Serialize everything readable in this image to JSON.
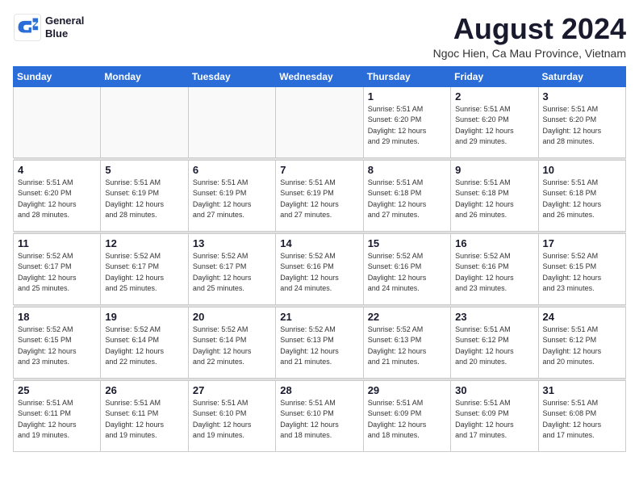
{
  "logo": {
    "line1": "General",
    "line2": "Blue"
  },
  "title": "August 2024",
  "location": "Ngoc Hien, Ca Mau Province, Vietnam",
  "weekdays": [
    "Sunday",
    "Monday",
    "Tuesday",
    "Wednesday",
    "Thursday",
    "Friday",
    "Saturday"
  ],
  "weeks": [
    [
      {
        "day": "",
        "info": ""
      },
      {
        "day": "",
        "info": ""
      },
      {
        "day": "",
        "info": ""
      },
      {
        "day": "",
        "info": ""
      },
      {
        "day": "1",
        "info": "Sunrise: 5:51 AM\nSunset: 6:20 PM\nDaylight: 12 hours\nand 29 minutes."
      },
      {
        "day": "2",
        "info": "Sunrise: 5:51 AM\nSunset: 6:20 PM\nDaylight: 12 hours\nand 29 minutes."
      },
      {
        "day": "3",
        "info": "Sunrise: 5:51 AM\nSunset: 6:20 PM\nDaylight: 12 hours\nand 28 minutes."
      }
    ],
    [
      {
        "day": "4",
        "info": "Sunrise: 5:51 AM\nSunset: 6:20 PM\nDaylight: 12 hours\nand 28 minutes."
      },
      {
        "day": "5",
        "info": "Sunrise: 5:51 AM\nSunset: 6:19 PM\nDaylight: 12 hours\nand 28 minutes."
      },
      {
        "day": "6",
        "info": "Sunrise: 5:51 AM\nSunset: 6:19 PM\nDaylight: 12 hours\nand 27 minutes."
      },
      {
        "day": "7",
        "info": "Sunrise: 5:51 AM\nSunset: 6:19 PM\nDaylight: 12 hours\nand 27 minutes."
      },
      {
        "day": "8",
        "info": "Sunrise: 5:51 AM\nSunset: 6:18 PM\nDaylight: 12 hours\nand 27 minutes."
      },
      {
        "day": "9",
        "info": "Sunrise: 5:51 AM\nSunset: 6:18 PM\nDaylight: 12 hours\nand 26 minutes."
      },
      {
        "day": "10",
        "info": "Sunrise: 5:51 AM\nSunset: 6:18 PM\nDaylight: 12 hours\nand 26 minutes."
      }
    ],
    [
      {
        "day": "11",
        "info": "Sunrise: 5:52 AM\nSunset: 6:17 PM\nDaylight: 12 hours\nand 25 minutes."
      },
      {
        "day": "12",
        "info": "Sunrise: 5:52 AM\nSunset: 6:17 PM\nDaylight: 12 hours\nand 25 minutes."
      },
      {
        "day": "13",
        "info": "Sunrise: 5:52 AM\nSunset: 6:17 PM\nDaylight: 12 hours\nand 25 minutes."
      },
      {
        "day": "14",
        "info": "Sunrise: 5:52 AM\nSunset: 6:16 PM\nDaylight: 12 hours\nand 24 minutes."
      },
      {
        "day": "15",
        "info": "Sunrise: 5:52 AM\nSunset: 6:16 PM\nDaylight: 12 hours\nand 24 minutes."
      },
      {
        "day": "16",
        "info": "Sunrise: 5:52 AM\nSunset: 6:16 PM\nDaylight: 12 hours\nand 23 minutes."
      },
      {
        "day": "17",
        "info": "Sunrise: 5:52 AM\nSunset: 6:15 PM\nDaylight: 12 hours\nand 23 minutes."
      }
    ],
    [
      {
        "day": "18",
        "info": "Sunrise: 5:52 AM\nSunset: 6:15 PM\nDaylight: 12 hours\nand 23 minutes."
      },
      {
        "day": "19",
        "info": "Sunrise: 5:52 AM\nSunset: 6:14 PM\nDaylight: 12 hours\nand 22 minutes."
      },
      {
        "day": "20",
        "info": "Sunrise: 5:52 AM\nSunset: 6:14 PM\nDaylight: 12 hours\nand 22 minutes."
      },
      {
        "day": "21",
        "info": "Sunrise: 5:52 AM\nSunset: 6:13 PM\nDaylight: 12 hours\nand 21 minutes."
      },
      {
        "day": "22",
        "info": "Sunrise: 5:52 AM\nSunset: 6:13 PM\nDaylight: 12 hours\nand 21 minutes."
      },
      {
        "day": "23",
        "info": "Sunrise: 5:51 AM\nSunset: 6:12 PM\nDaylight: 12 hours\nand 20 minutes."
      },
      {
        "day": "24",
        "info": "Sunrise: 5:51 AM\nSunset: 6:12 PM\nDaylight: 12 hours\nand 20 minutes."
      }
    ],
    [
      {
        "day": "25",
        "info": "Sunrise: 5:51 AM\nSunset: 6:11 PM\nDaylight: 12 hours\nand 19 minutes."
      },
      {
        "day": "26",
        "info": "Sunrise: 5:51 AM\nSunset: 6:11 PM\nDaylight: 12 hours\nand 19 minutes."
      },
      {
        "day": "27",
        "info": "Sunrise: 5:51 AM\nSunset: 6:10 PM\nDaylight: 12 hours\nand 19 minutes."
      },
      {
        "day": "28",
        "info": "Sunrise: 5:51 AM\nSunset: 6:10 PM\nDaylight: 12 hours\nand 18 minutes."
      },
      {
        "day": "29",
        "info": "Sunrise: 5:51 AM\nSunset: 6:09 PM\nDaylight: 12 hours\nand 18 minutes."
      },
      {
        "day": "30",
        "info": "Sunrise: 5:51 AM\nSunset: 6:09 PM\nDaylight: 12 hours\nand 17 minutes."
      },
      {
        "day": "31",
        "info": "Sunrise: 5:51 AM\nSunset: 6:08 PM\nDaylight: 12 hours\nand 17 minutes."
      }
    ]
  ]
}
